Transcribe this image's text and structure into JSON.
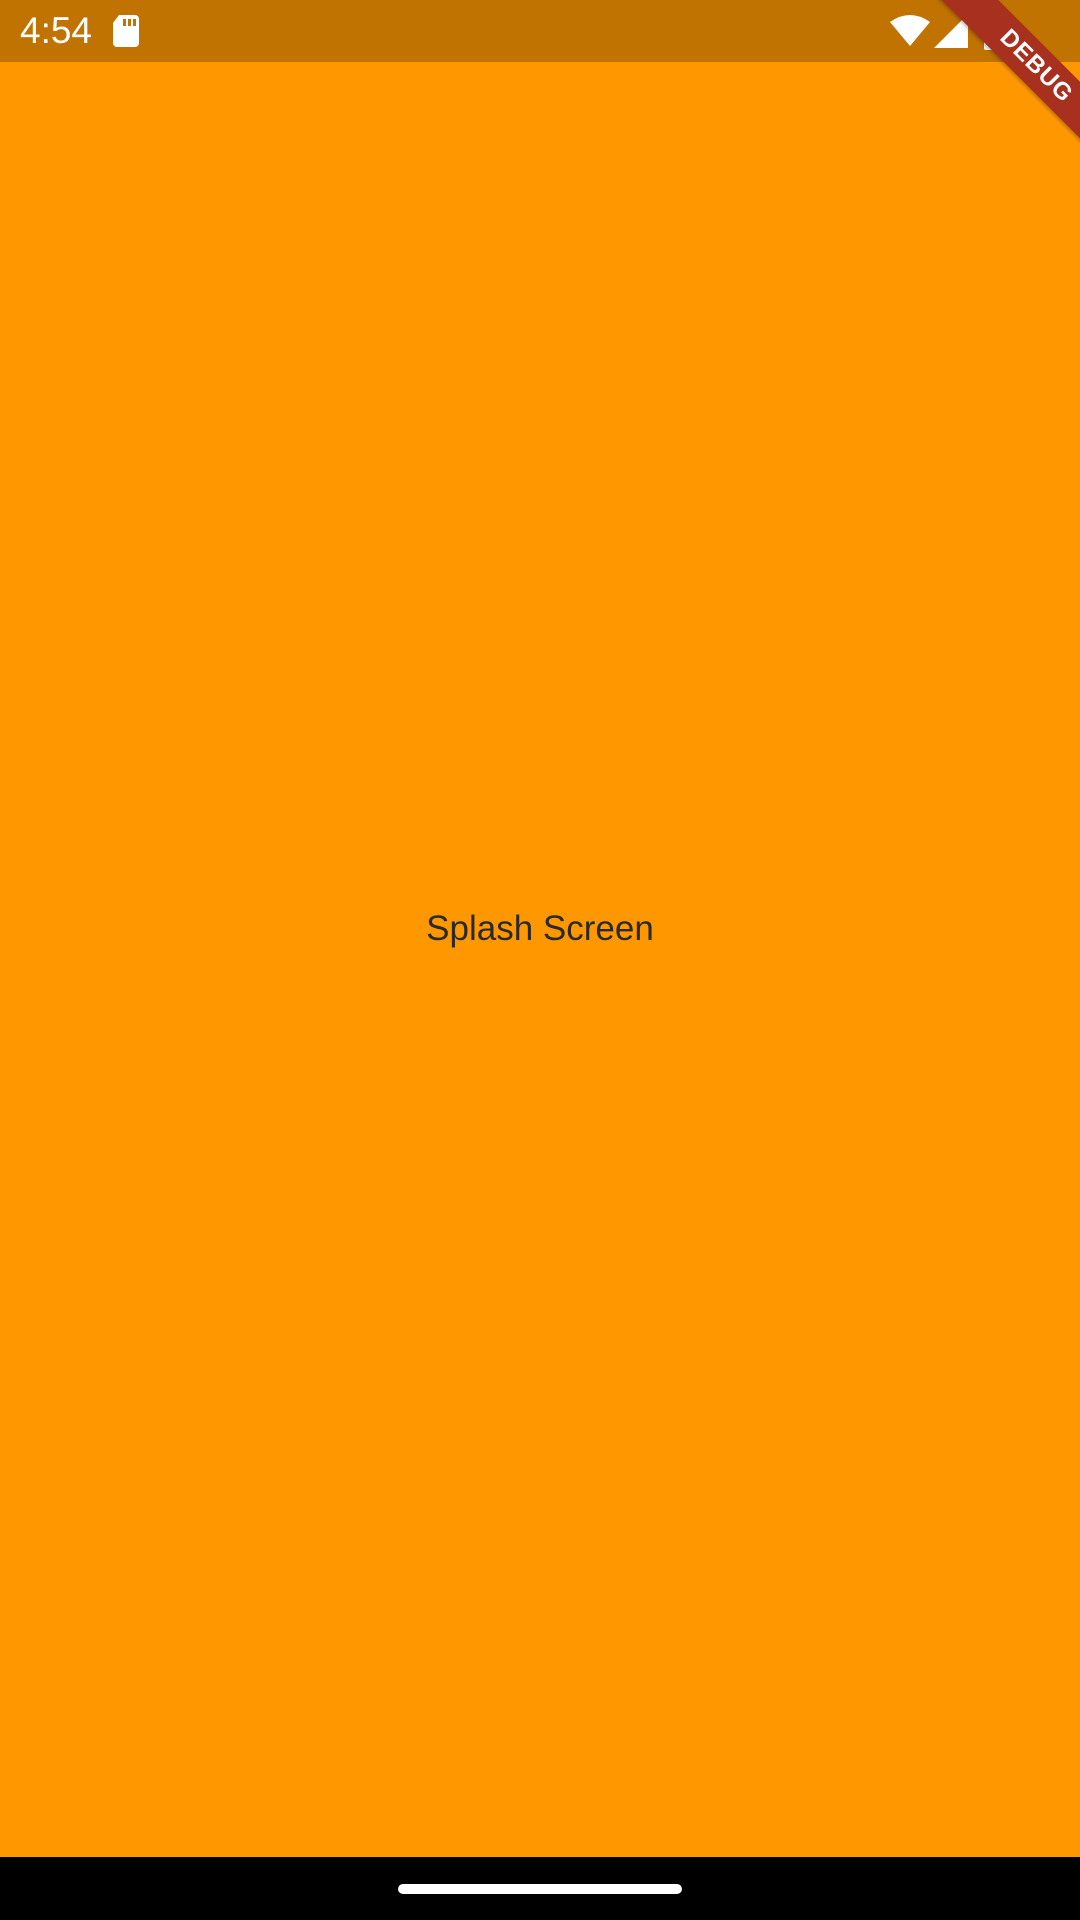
{
  "status_bar": {
    "time": "4:54",
    "icons": [
      "sd-card-icon",
      "wifi-icon",
      "signal-icon",
      "battery-icon"
    ]
  },
  "debug_banner": {
    "label": "DEBUG"
  },
  "main": {
    "text": "Splash Screen"
  },
  "colors": {
    "background": "#FF9800",
    "status_bar": "#C07300",
    "banner": "#A8301E",
    "text": "#2a2a2a"
  }
}
